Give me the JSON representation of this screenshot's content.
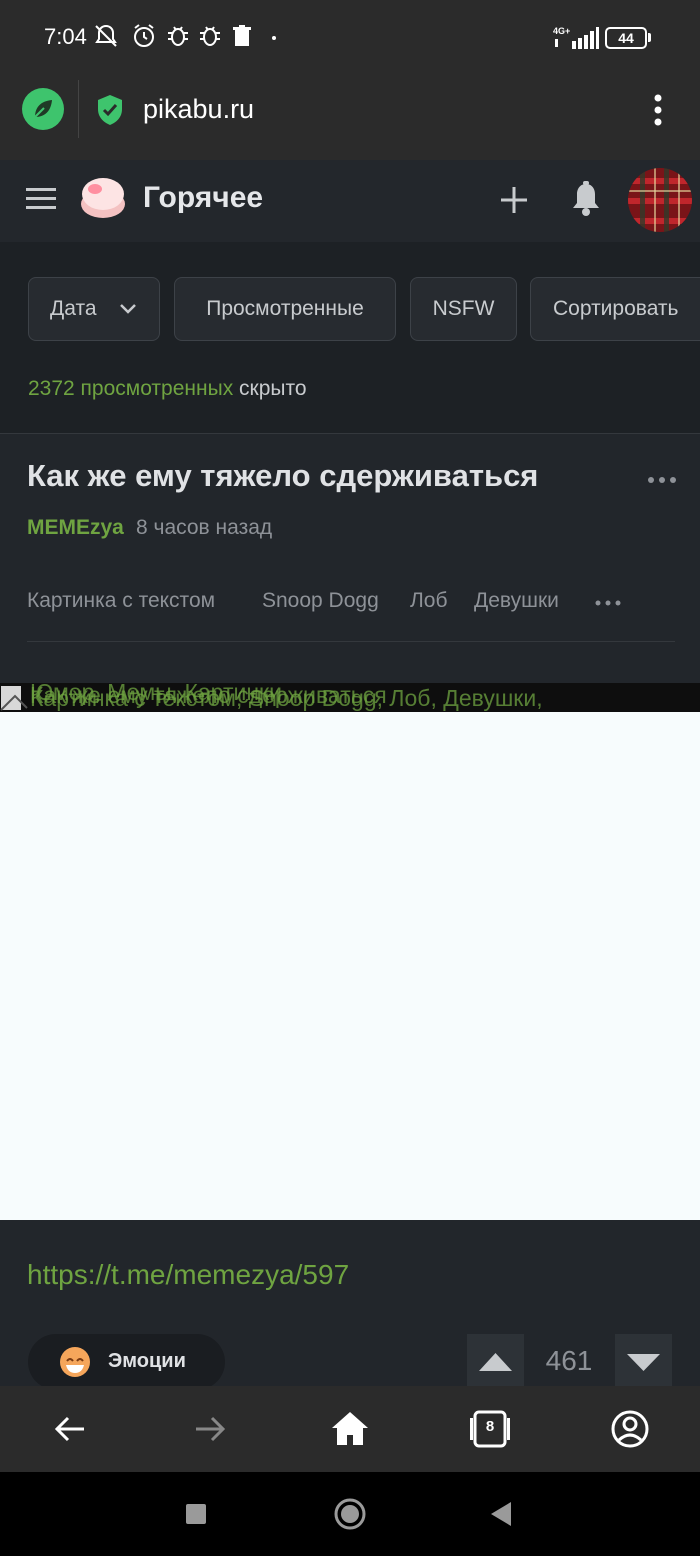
{
  "status_bar": {
    "time": "7:04",
    "network": "4G+",
    "battery": "44"
  },
  "browser": {
    "url": "pikabu.ru"
  },
  "header": {
    "title": "Горячее"
  },
  "filters": {
    "date": "Дата",
    "viewed": "Просмотренные",
    "nsfw": "NSFW",
    "sort": "Сортировать",
    "hidden_count": "2372 просмотренных",
    "hidden_suffix": " скрыто"
  },
  "post": {
    "title": "Как же ему тяжело сдерживаться",
    "author": "MEMEzya",
    "time": "8 часов назад",
    "tags": [
      "Картинка с текстом",
      "Snoop Dogg",
      "Лоб",
      "Девушки"
    ],
    "image_alt_lines": [
      "Как же ему тяжело сдерживаться",
      "Картинка с текстом, Snoop Dogg, Лоб, Девушки,",
      "Юмор, Мемы, Картинки"
    ],
    "link": "https://t.me/memezya/597",
    "emotions_label": "Эмоции",
    "rating": "461"
  },
  "nav": {
    "tabs_count": "8"
  },
  "colors": {
    "accent_green": "#6fa441",
    "browser_logo": "#3ec46d",
    "background": "#22262b"
  }
}
